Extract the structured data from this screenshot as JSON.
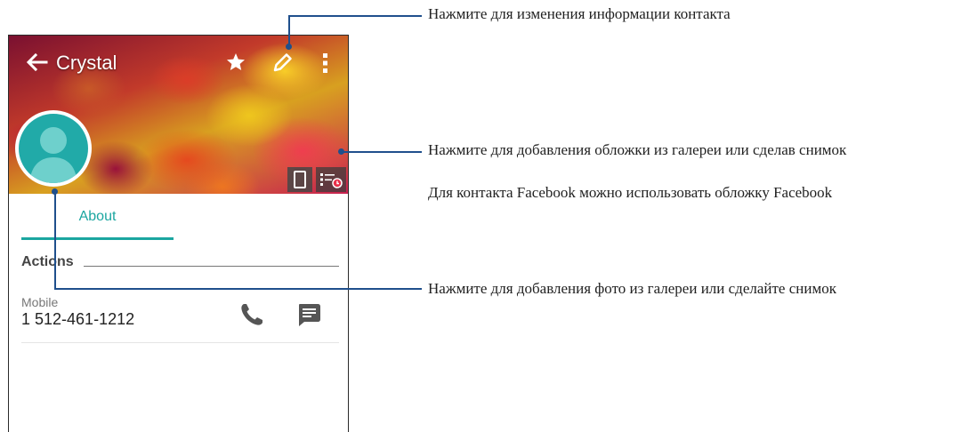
{
  "contact": {
    "name": "Crystal",
    "tab_about": "About",
    "section_actions": "Actions",
    "phone_type": "Mobile",
    "phone_number": "1 512-461-1212"
  },
  "icons": {
    "back": "arrow-left-icon",
    "favorite": "star-icon",
    "edit": "pencil-icon",
    "more": "more-vertical-icon",
    "avatar": "person-silhouette-icon",
    "cover_camera": "phone-camera-icon",
    "cover_gallery": "gallery-icon",
    "call": "phone-icon",
    "message": "message-icon"
  },
  "colors": {
    "accent": "#1ba6a0",
    "avatar_bg": "#21aaa8",
    "callout": "#1f4f8c"
  },
  "callouts": {
    "edit": "Нажмите для изменения информации контакта",
    "cover": "Нажмите для добавления обложки из галереи или сделав снимок",
    "facebook": "Для контакта Facebook можно использовать обложку Facebook",
    "photo": "Нажмите для добавления фото из галереи или сделайте снимок"
  }
}
